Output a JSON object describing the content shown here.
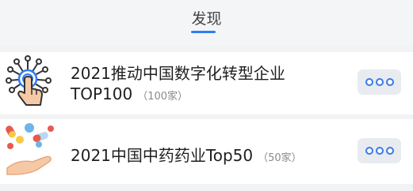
{
  "header": {
    "title": "发现"
  },
  "colors": {
    "accent": "#2f7df6",
    "card_bg": "#ffffff",
    "page_bg": "#f2f3f5"
  },
  "list": [
    {
      "icon": "touch-network-icon",
      "title_line1": "2021推动中国数字化转型企业",
      "title_line2": "TOP100",
      "count": "（100家）",
      "more_icon": "more-dots-icon"
    },
    {
      "icon": "pills-hand-icon",
      "title_line1": "2021中国中药药业Top50",
      "count": "（50家）",
      "more_icon": "more-dots-icon"
    }
  ]
}
